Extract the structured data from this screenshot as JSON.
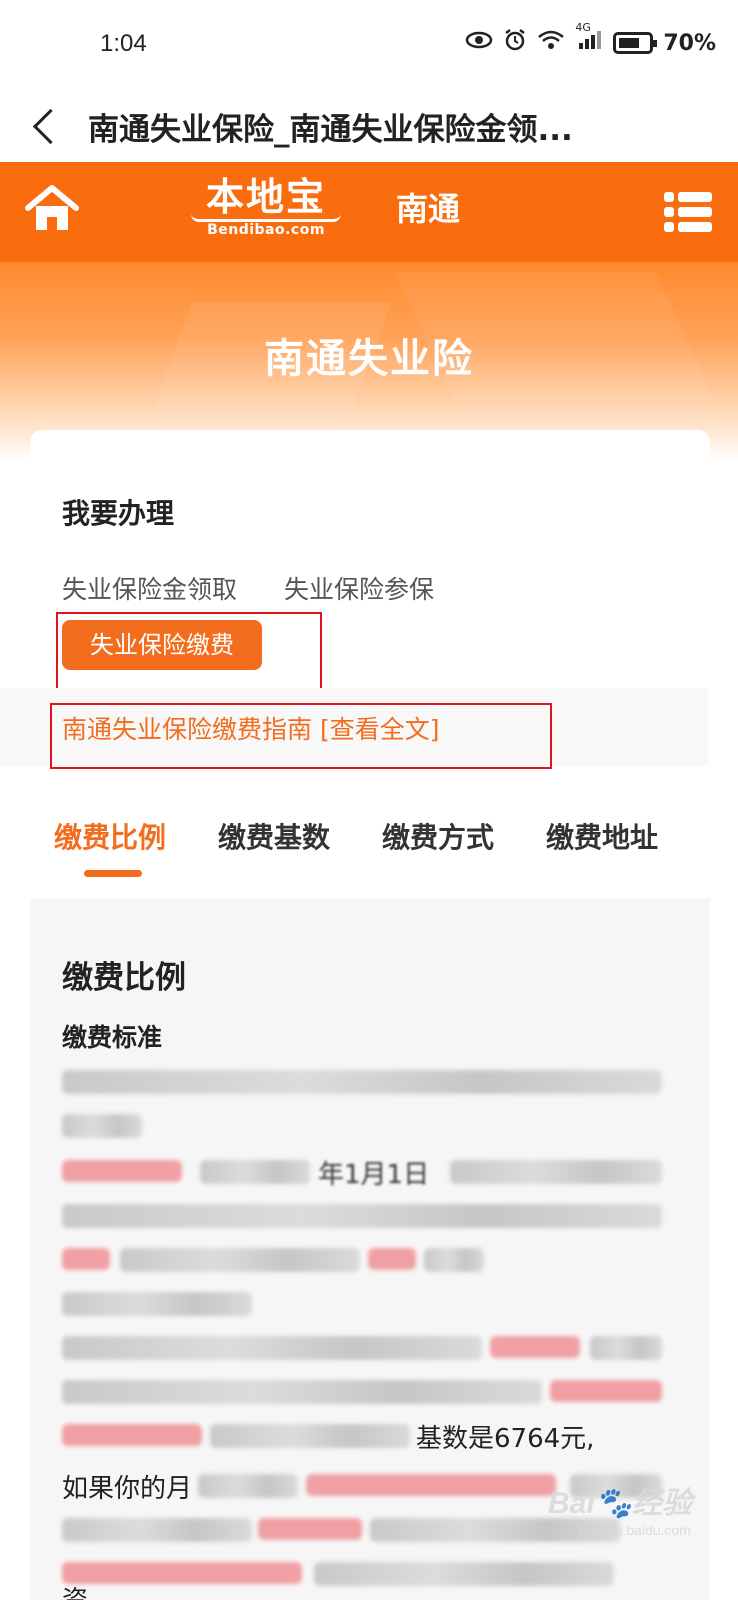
{
  "status": {
    "time": "1:04",
    "network": "4G",
    "battery": "70%",
    "battery_level": 0.7
  },
  "titlebar": {
    "title": "南通失业保险_南通失业保险金领..."
  },
  "header": {
    "logo_text": "本地宝",
    "logo_sub": "Bendibao.com",
    "city": "南通"
  },
  "banner": {
    "title": "南通失业险"
  },
  "services": {
    "heading": "我要办理",
    "items": [
      "失业保险金领取",
      "失业保险参保"
    ],
    "active": "失业保险缴费",
    "guide_link": "南通失业保险缴费指南 [查看全文]"
  },
  "tabs": [
    "缴费比例",
    "缴费基数",
    "缴费方式",
    "缴费地址"
  ],
  "content": {
    "heading": "缴费比例",
    "subheading": "缴费标准",
    "partial_1": "年1月1日",
    "partial_2": "基数是6764元,",
    "partial_3": "如果你的月",
    "partial_4": "资"
  },
  "watermark": {
    "main": "Bai",
    "sub": "jingyan.baidu.com",
    "suffix": "经验"
  }
}
